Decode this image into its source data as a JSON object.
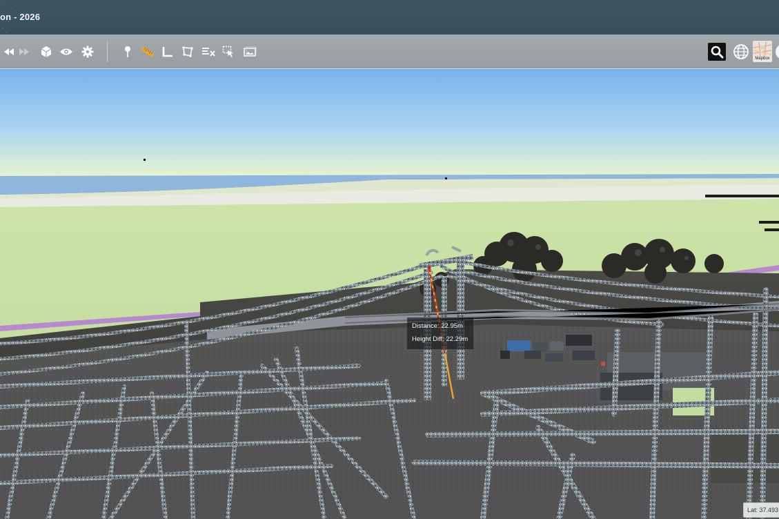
{
  "window": {
    "title": "on - 2026"
  },
  "toolbar": {
    "left_icons": [
      {
        "name": "rewind-icon"
      },
      {
        "name": "fast-forward-icon"
      },
      {
        "name": "cube-icon"
      },
      {
        "name": "eye-icon"
      },
      {
        "name": "gear-icon"
      }
    ],
    "tool_icons": [
      {
        "name": "pin-marker-icon"
      },
      {
        "name": "ruler-icon"
      },
      {
        "name": "angle-icon"
      },
      {
        "name": "polygon-area-icon"
      },
      {
        "name": "clear-measurements-icon"
      },
      {
        "name": "select-cursor-icon"
      },
      {
        "name": "screenshot-icon"
      }
    ],
    "right_icons": [
      {
        "name": "search-icon"
      },
      {
        "name": "globe-icon"
      },
      {
        "name": "basemap-icon",
        "label": "Mapbox"
      }
    ]
  },
  "measurement": {
    "distance_label": "Distance: 22.95m",
    "height_diff_label": "Height Diff: 22.29m"
  },
  "coordinates": {
    "lat_label": "Lat: 37.493"
  },
  "colors": {
    "titlebar": "#3d5462",
    "toolbar": "#9ea3a7",
    "sky_top": "#79b3ec",
    "sky_horizon": "#e7f3d0",
    "ground": "#c5dfa1",
    "measure_line": "#f0a62a",
    "measure_height": "#d21f1f"
  }
}
